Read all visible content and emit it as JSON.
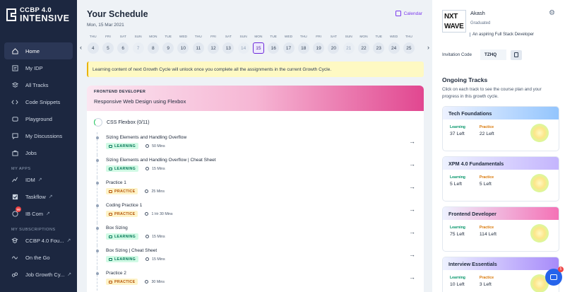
{
  "brand": {
    "line1": "CCBP 4.0",
    "line2": "INTENSIVE"
  },
  "sidebar": {
    "items": [
      {
        "label": "Home",
        "icon": "home-icon"
      },
      {
        "label": "My IDP",
        "icon": "idp-icon"
      },
      {
        "label": "All Tracks",
        "icon": "tracks-icon"
      },
      {
        "label": "Code Snippets",
        "icon": "code-icon"
      },
      {
        "label": "Playground",
        "icon": "playground-icon"
      },
      {
        "label": "My Discussions",
        "icon": "discussions-icon"
      },
      {
        "label": "Jobs",
        "icon": "jobs-icon"
      }
    ],
    "apps_heading": "MY APPS",
    "apps": [
      {
        "label": "IDM"
      },
      {
        "label": "Taskflow"
      },
      {
        "label": "IB Com",
        "badge": "99"
      }
    ],
    "subs_heading": "MY SUBSCRIPTIONS",
    "subs": [
      {
        "label": "CCBP 4.0 Fou..."
      },
      {
        "label": "On the Go"
      },
      {
        "label": "Job Growth Cy..."
      }
    ]
  },
  "schedule": {
    "title": "Your Schedule",
    "date": "Mon, 15 Mar 2021",
    "calendar_label": "Calendar",
    "days": [
      {
        "d": "THU",
        "n": "4"
      },
      {
        "d": "FRI",
        "n": "5"
      },
      {
        "d": "SAT",
        "n": "6"
      },
      {
        "d": "SUN",
        "n": "7"
      },
      {
        "d": "MON",
        "n": "8"
      },
      {
        "d": "TUE",
        "n": "9"
      },
      {
        "d": "WED",
        "n": "10"
      },
      {
        "d": "THU",
        "n": "11"
      },
      {
        "d": "FRI",
        "n": "12"
      },
      {
        "d": "SAT",
        "n": "13"
      },
      {
        "d": "SUN",
        "n": "14"
      },
      {
        "d": "MON",
        "n": "15"
      },
      {
        "d": "TUE",
        "n": "16"
      },
      {
        "d": "WED",
        "n": "17"
      },
      {
        "d": "THU",
        "n": "18"
      },
      {
        "d": "FRI",
        "n": "19"
      },
      {
        "d": "SAT",
        "n": "20"
      },
      {
        "d": "SUN",
        "n": "21"
      },
      {
        "d": "MON",
        "n": "22"
      },
      {
        "d": "TUE",
        "n": "23"
      },
      {
        "d": "WED",
        "n": "24"
      },
      {
        "d": "THU",
        "n": "25"
      }
    ],
    "banner": "Learning content of next Growth Cycle will unlock once you complete all the assignments in the current Growth Cycle."
  },
  "track": {
    "tag": "FRONTEND DEVELOPER",
    "name": "Responsive Web Design using Flexbox",
    "module": "CSS Flexbox (0/11)",
    "items": [
      {
        "name": "Sizing Elements and Handling Overflow",
        "type": "LEARNING",
        "duration": "50 Mins"
      },
      {
        "name": "Sizing Elements and Handling Overflow | Cheat Sheet",
        "type": "LEARNING",
        "duration": "15 Mins"
      },
      {
        "name": "Practice 1",
        "type": "PRACTICE",
        "duration": "25 Mins"
      },
      {
        "name": "Coding Practice 1",
        "type": "PRACTICE",
        "duration": "1 Hr 30 Mins"
      },
      {
        "name": "Box Sizing",
        "type": "LEARNING",
        "duration": "15 Mins"
      },
      {
        "name": "Box Sizing | Cheat Sheet",
        "type": "LEARNING",
        "duration": "15 Mins"
      },
      {
        "name": "Practice 2",
        "type": "PRACTICE",
        "duration": "30 Mins"
      }
    ]
  },
  "profile": {
    "logo_l1": "NXT",
    "logo_l2": "WAVE",
    "name": "Akash",
    "status": "Graduated",
    "aspiration": "An aspiring Full Stack Developer",
    "invite_label": "Invitation Code",
    "invite_code": "TZHQ"
  },
  "ongoing": {
    "title": "Ongoing Tracks",
    "desc": "Click on each track to see the course plan and your progress in this growth cycle.",
    "learning_label": "Learning",
    "practice_label": "Practice",
    "tracks": [
      {
        "name": "Tech Foundations",
        "learning": "37 Left",
        "practice": "22 Left",
        "color": "#93c5fd"
      },
      {
        "name": "XPM 4.0 Fundamentals",
        "learning": "5 Left",
        "practice": "5 Left",
        "color": "#c4b5fd"
      },
      {
        "name": "Frontend Developer",
        "learning": "75 Left",
        "practice": "114 Left",
        "color": "#f472b6"
      },
      {
        "name": "Interview Essentials",
        "learning": "10 Left",
        "practice": "3 Left",
        "color": "#a78bfa"
      }
    ]
  },
  "chat": {
    "count": "5"
  }
}
